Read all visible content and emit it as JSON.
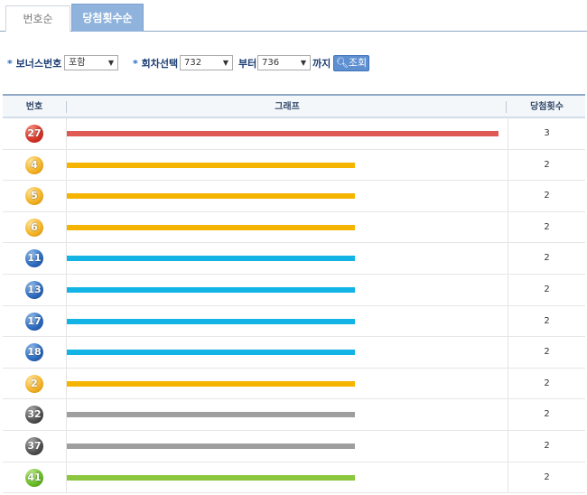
{
  "tabs": [
    {
      "label": "번호순",
      "active": false
    },
    {
      "label": "당첨횟수순",
      "active": true
    }
  ],
  "filters": {
    "bonus_label": "보너스번호",
    "bonus_value": "포함",
    "round_label": "회차선택",
    "round_from": "732",
    "from_suffix": "부터",
    "round_to": "736",
    "to_suffix": "까지",
    "search_button": "조회"
  },
  "table": {
    "headers": [
      "번호",
      "그래프",
      "당첨횟수"
    ]
  },
  "colors": {
    "red": "#e05a55",
    "yellow": "#f5b400",
    "blue": "#12b4e6",
    "gray": "#9e9e9e",
    "green": "#8cc63f"
  },
  "chart_data": {
    "type": "bar",
    "categories": [
      "27",
      "4",
      "5",
      "6",
      "11",
      "13",
      "17",
      "18",
      "2",
      "32",
      "37",
      "41"
    ],
    "values": [
      3,
      2,
      2,
      2,
      2,
      2,
      2,
      2,
      2,
      2,
      2,
      2
    ],
    "ball_colors": [
      "red",
      "yellow",
      "yellow",
      "yellow",
      "blue",
      "blue",
      "blue",
      "blue",
      "yellow",
      "gray",
      "gray",
      "green"
    ],
    "max": 3
  }
}
